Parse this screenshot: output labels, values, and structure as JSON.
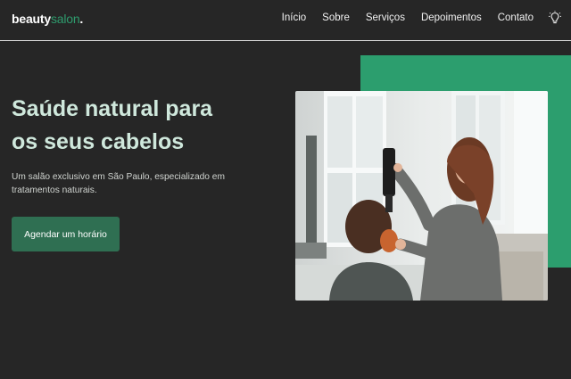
{
  "brand": {
    "part1": "beauty",
    "part2": "salon",
    "dot": "."
  },
  "nav": {
    "items": [
      "Início",
      "Sobre",
      "Serviços",
      "Depoimentos",
      "Contato"
    ]
  },
  "hero": {
    "title_line1": "Saúde natural para",
    "title_line2": "os seus cabelos",
    "subtitle_line1": "Um salão exclusivo em São Paulo, especializado em",
    "subtitle_line2": "tratamentos naturais.",
    "cta_label": "Agendar um horário"
  },
  "icons": {
    "theme_toggle": "lightbulb-icon"
  },
  "colors": {
    "background": "#262626",
    "accent": "#2c9e6e",
    "button": "#2f6f52",
    "title": "#cfe8dc"
  }
}
